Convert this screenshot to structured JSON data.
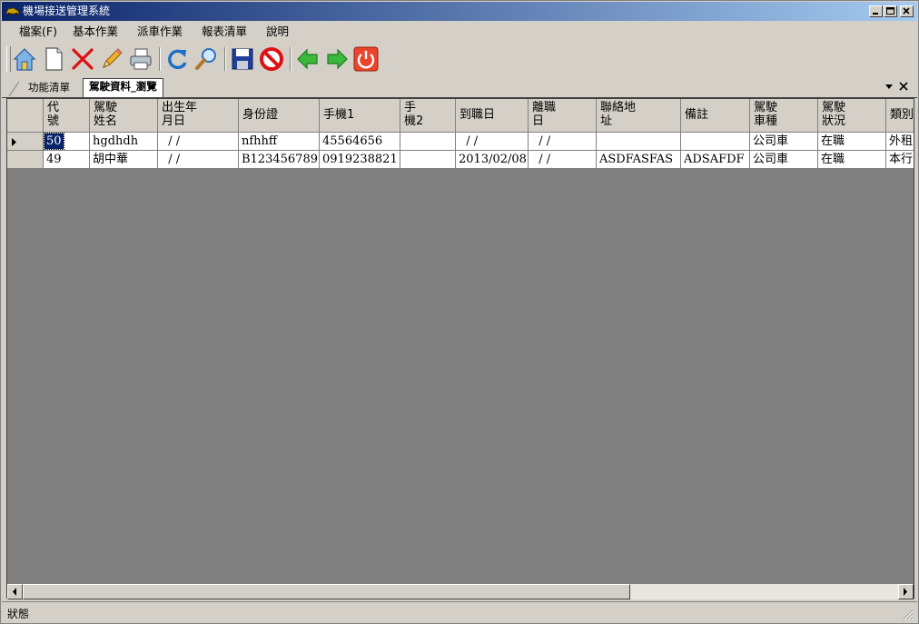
{
  "window": {
    "title": "機場接送管理系統"
  },
  "menu": [
    {
      "label": "檔案(F)"
    },
    {
      "label": "基本作業"
    },
    {
      "label": "派車作業"
    },
    {
      "label": "報表清單"
    },
    {
      "label": "說明"
    }
  ],
  "toolbar": {
    "buttons": [
      {
        "name": "home-icon"
      },
      {
        "name": "new-document-icon"
      },
      {
        "name": "delete-x-icon"
      },
      {
        "name": "edit-pencil-icon"
      },
      {
        "name": "print-icon"
      },
      {
        "name": "refresh-icon"
      },
      {
        "name": "search-magnifier-icon"
      },
      {
        "name": "save-disk-icon"
      },
      {
        "name": "cancel-stop-icon"
      },
      {
        "name": "previous-arrow-icon"
      },
      {
        "name": "next-arrow-icon"
      },
      {
        "name": "exit-power-icon"
      }
    ]
  },
  "tabs": [
    {
      "label": "功能清單"
    },
    {
      "label": "駕駛資料_瀏覽"
    }
  ],
  "grid": {
    "columns": [
      {
        "label": "代\n號"
      },
      {
        "label": "駕駛\n姓名"
      },
      {
        "label": "出生年\n月日"
      },
      {
        "label": "身份證"
      },
      {
        "label": "手機1"
      },
      {
        "label": "手\n機2"
      },
      {
        "label": "到職日"
      },
      {
        "label": "離職\n日"
      },
      {
        "label": "聯絡地\n址"
      },
      {
        "label": "備註"
      },
      {
        "label": "駕駛\n車種"
      },
      {
        "label": "駕駛\n狀況"
      },
      {
        "label": "類別"
      }
    ],
    "rows": [
      {
        "cells": [
          "50",
          "hgdhdh",
          "  / /",
          "nfhhff",
          "45564656",
          "",
          "  / /",
          "  / /",
          "",
          "",
          "公司車",
          "在職",
          "外租"
        ]
      },
      {
        "cells": [
          "49",
          "胡中華",
          "  / /",
          "B123456789",
          "0919238821",
          "",
          "2013/02/08",
          "  / /",
          "ASDFASFAS",
          "ADSAFDF",
          "公司車",
          "在職",
          "本行"
        ]
      }
    ]
  },
  "status": {
    "text": "狀態"
  }
}
